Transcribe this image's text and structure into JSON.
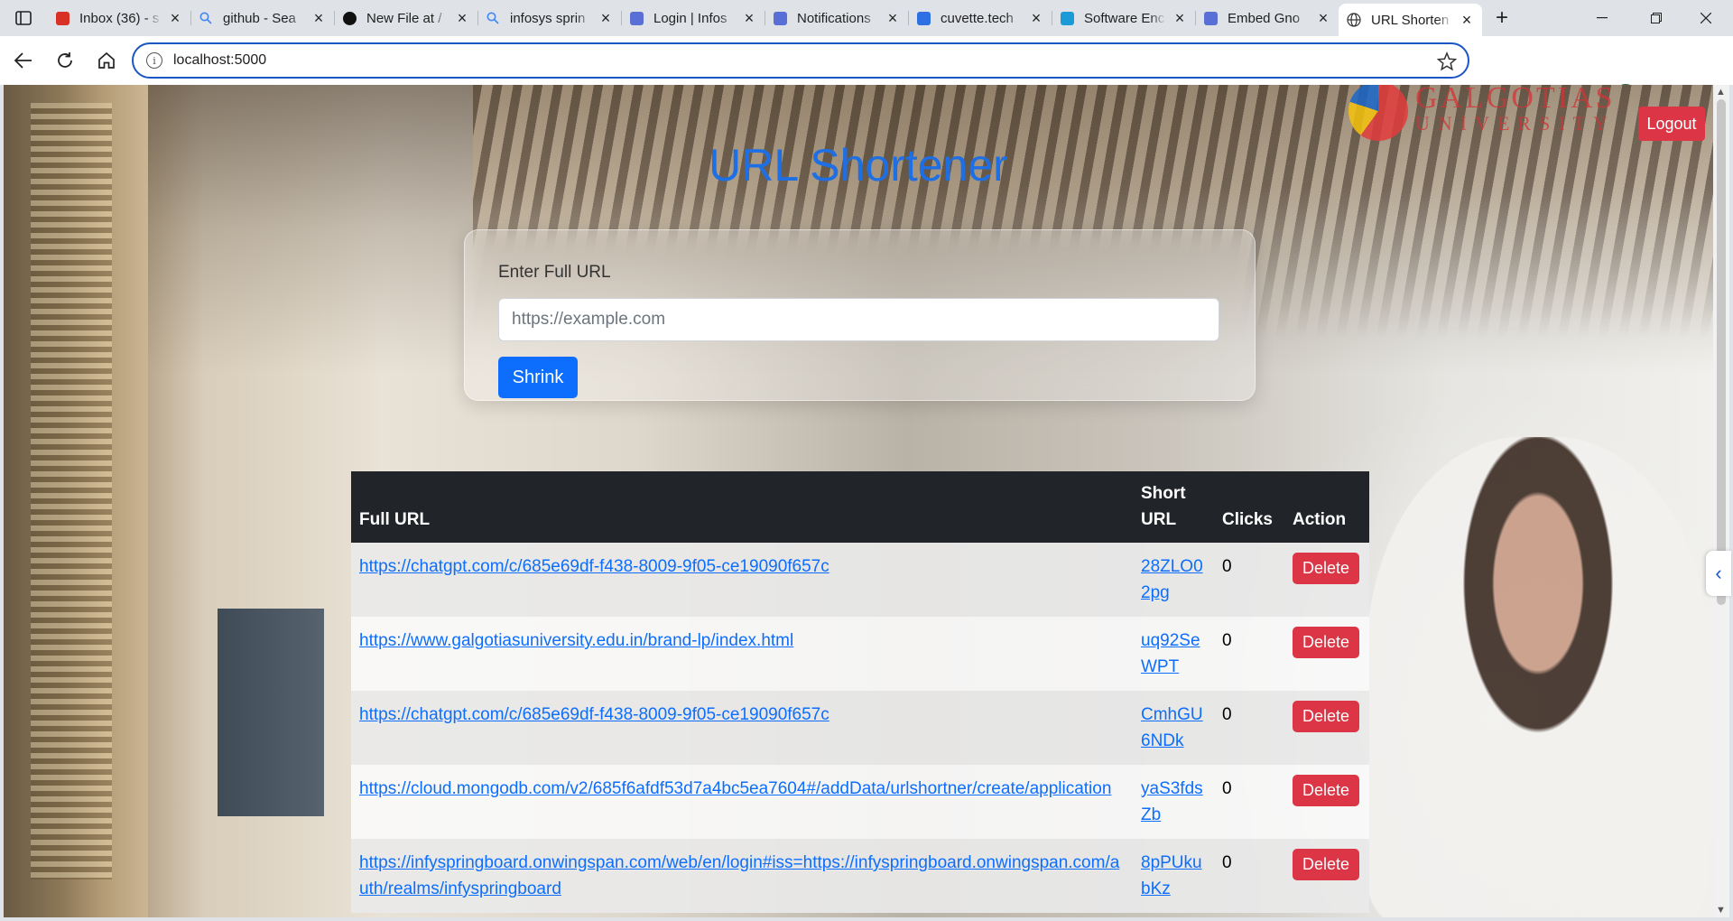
{
  "browser": {
    "tabs": [
      {
        "title": "Inbox (36) - s",
        "icon": "gmail-icon"
      },
      {
        "title": "github - Sea",
        "icon": "search-icon"
      },
      {
        "title": "New File at /",
        "icon": "github-icon"
      },
      {
        "title": "infosys sprin",
        "icon": "search-icon"
      },
      {
        "title": "Login | Infos",
        "icon": "springboard-icon"
      },
      {
        "title": "Notifications",
        "icon": "springboard-icon"
      },
      {
        "title": "cuvette.tech",
        "icon": "cuvette-icon"
      },
      {
        "title": "Software Enc",
        "icon": "edge-icon"
      },
      {
        "title": "Embed Gno",
        "icon": "springboard-icon"
      },
      {
        "title": "URL Shorten",
        "icon": "globe-icon",
        "active": true
      }
    ],
    "address": "localhost:5000"
  },
  "page": {
    "logo": {
      "name": "GALGOTIAS",
      "sub": "UNIVERSITY"
    },
    "logout_label": "Logout",
    "title": "URL Shortener",
    "form": {
      "label": "Enter Full URL",
      "placeholder": "https://example.com",
      "button_label": "Shrink"
    },
    "table": {
      "headers": {
        "full": "Full URL",
        "short": "Short URL",
        "clicks": "Clicks",
        "action": "Action"
      },
      "rows": [
        {
          "full": "https://chatgpt.com/c/685e69df-f438-8009-9f05-ce19090f657c",
          "short": "28ZLO02pg",
          "clicks": "0",
          "action": "Delete"
        },
        {
          "full": "https://www.galgotiasuniversity.edu.in/brand-lp/index.html",
          "short": "uq92SeWPT",
          "clicks": "0",
          "action": "Delete"
        },
        {
          "full": "https://chatgpt.com/c/685e69df-f438-8009-9f05-ce19090f657c",
          "short": "CmhGU6NDk",
          "clicks": "0",
          "action": "Delete"
        },
        {
          "full": "https://cloud.mongodb.com/v2/685f6afdf53d7a4bc5ea7604#/addData/urlshortner/create/application",
          "short": "yaS3fdsZb",
          "clicks": "0",
          "action": "Delete"
        },
        {
          "full": "https://infyspringboard.onwingspan.com/web/en/login#iss=https://infyspringboard.onwingspan.com/auth/realms/infyspringboard",
          "short": "8pPUkubKz",
          "clicks": "0",
          "action": "Delete"
        }
      ]
    }
  },
  "colors": {
    "primary": "#0d6efd",
    "danger": "#dc3545",
    "title": "#1e6fe3",
    "table_header": "#212529"
  }
}
